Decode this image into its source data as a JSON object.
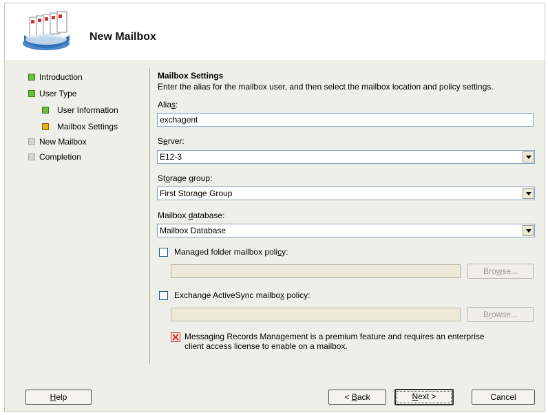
{
  "header": {
    "title": "New Mailbox"
  },
  "nav": {
    "items": [
      {
        "label": "Introduction",
        "state": "done"
      },
      {
        "label": "User Type",
        "state": "done"
      },
      {
        "label": "User Information",
        "state": "done"
      },
      {
        "label": "Mailbox Settings",
        "state": "current"
      },
      {
        "label": "New Mailbox",
        "state": "pending"
      },
      {
        "label": "Completion",
        "state": "pending"
      }
    ]
  },
  "content": {
    "title": "Mailbox Settings",
    "description": "Enter the alias for the mailbox user, and then select the mailbox location and policy settings.",
    "alias_label_pre": "Alia",
    "alias_label_key": "s",
    "alias_label_post": ":",
    "alias_value": "exchagent",
    "server_label_pre": "S",
    "server_label_key": "e",
    "server_label_post": "rver:",
    "server_value": "E12-3",
    "storage_label_pre": "St",
    "storage_label_key": "o",
    "storage_label_post": "rage group:",
    "storage_value": "First Storage Group",
    "database_label_pre": "Mailbox ",
    "database_label_key": "d",
    "database_label_post": "atabase:",
    "database_value": "Mailbox Database",
    "managed_policy_pre": "Managed folder mailbox poli",
    "managed_policy_key": "c",
    "managed_policy_post": "y:",
    "managed_browse_pre": "Bro",
    "managed_browse_key": "w",
    "managed_browse_post": "se...",
    "activesync_policy_pre": "Exchange ActiveSync mailbo",
    "activesync_policy_key": "x",
    "activesync_policy_post": " policy:",
    "activesync_browse_pre": "B",
    "activesync_browse_key": "r",
    "activesync_browse_post": "owse...",
    "notice_line1": "Messaging Records Management is a premium feature and requires an enterprise",
    "notice_line2": "client access license to enable on a mailbox."
  },
  "footer": {
    "help_key": "H",
    "help_rest": "elp",
    "back_pre": "< ",
    "back_key": "B",
    "back_post": "ack",
    "next_key": "N",
    "next_post": "ext >",
    "cancel": "Cancel"
  },
  "colors": {
    "done": "#6dbd3b",
    "current": "#e9b020",
    "pending": "#d6d6d0",
    "notice_icon": "#d62e2e"
  },
  "icons": {
    "header": "mailboxes-icon",
    "notice": "warning-icon"
  }
}
